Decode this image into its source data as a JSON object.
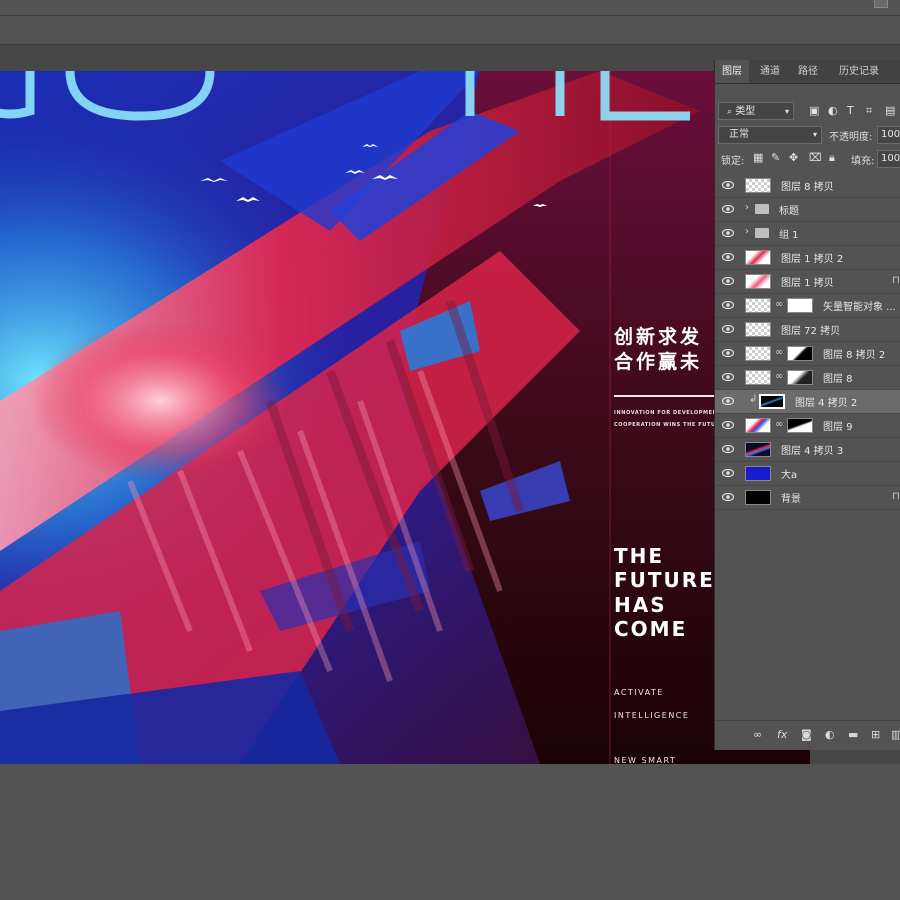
{
  "layers_panel": {
    "tabs": [
      {
        "label": "图层",
        "active": true
      },
      {
        "label": "通道",
        "active": false
      },
      {
        "label": "路径",
        "active": false
      },
      {
        "label": "历史记录",
        "active": false
      }
    ],
    "filter_type": "类型",
    "blend_mode": "正常",
    "opacity_label": "不透明度:",
    "opacity_value": "100",
    "lock_label": "锁定:",
    "fill_label": "填充:",
    "fill_value": "100",
    "layers": [
      {
        "name": "图层 8 拷贝",
        "kind": "pixel",
        "selected": false
      },
      {
        "name": "标题",
        "kind": "group",
        "selected": false
      },
      {
        "name": "组 1",
        "kind": "group",
        "selected": false
      },
      {
        "name": "图层 1 拷贝 2",
        "kind": "pixel",
        "selected": false
      },
      {
        "name": "图层 1 拷贝",
        "kind": "pixel",
        "selected": false,
        "locked": true
      },
      {
        "name": "矢量智能对象 ...",
        "kind": "smart-mask",
        "selected": false
      },
      {
        "name": "图层 72 拷贝",
        "kind": "pixel",
        "selected": false
      },
      {
        "name": "图层 8 拷贝 2",
        "kind": "masked",
        "selected": false
      },
      {
        "name": "图层 8",
        "kind": "masked",
        "selected": false
      },
      {
        "name": "图层 4 拷贝 2",
        "kind": "clipped",
        "selected": true
      },
      {
        "name": "图层 9",
        "kind": "masked",
        "selected": false
      },
      {
        "name": "图层 4 拷贝 3",
        "kind": "pixel",
        "selected": false
      },
      {
        "name": "大a",
        "kind": "pixel",
        "selected": false
      },
      {
        "name": "背景",
        "kind": "pixel",
        "selected": false,
        "locked": true
      }
    ]
  },
  "poster": {
    "title_cn_line1": "创新求发",
    "title_cn_line2": "合作赢未",
    "subtitle_en_line1": "INNOVATION FOR DEVELOPMENT",
    "subtitle_en_line2": "COOPERATION WINS THE FUTURE",
    "headline": [
      "THE",
      "FUTURE",
      "HAS",
      "COME"
    ],
    "tagline_1": "ACTIVATE",
    "tagline_2": "INTELLIGENCE",
    "tagline_3": "NEW SMART"
  },
  "colors": {
    "app_bg": "#535353",
    "panel_bg": "#535353",
    "selected_layer": "#6b6b6b",
    "poster_red": "#e2274e",
    "poster_blue": "#1b2fb0",
    "poster_cyan": "#38c8e8"
  }
}
